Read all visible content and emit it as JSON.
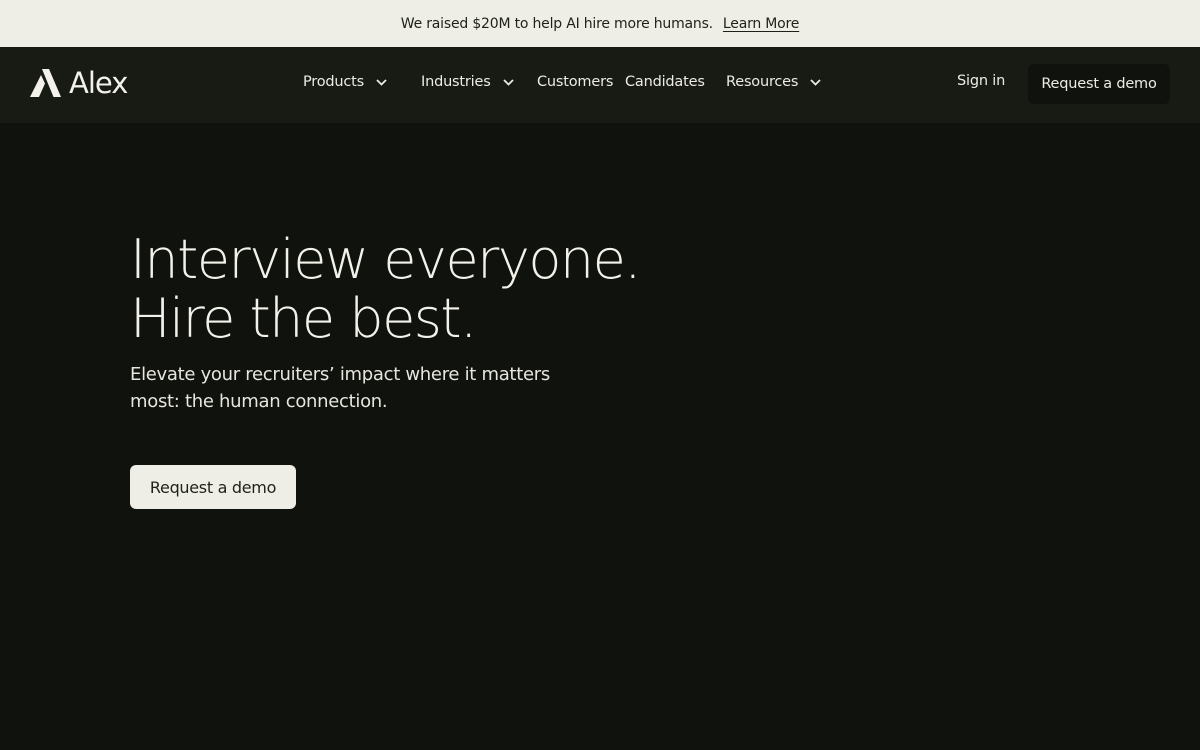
{
  "announcement": {
    "text": "We raised $20M to help AI hire more humans.",
    "link_label": "Learn More"
  },
  "header": {
    "logo_text": "Alex",
    "nav": [
      {
        "label": "Products",
        "has_dropdown": true
      },
      {
        "label": "Industries",
        "has_dropdown": true
      },
      {
        "label": "Customers",
        "has_dropdown": false
      },
      {
        "label": "Candidates",
        "has_dropdown": false
      },
      {
        "label": "Resources",
        "has_dropdown": true
      }
    ],
    "signin_label": "Sign in",
    "demo_label": "Request a demo"
  },
  "hero": {
    "title_line1": "Interview everyone.",
    "title_line2": "Hire the best.",
    "subtitle_line1": "Elevate your recruiters’ impact where it matters",
    "subtitle_line2": "most: the human connection.",
    "cta_label": "Request a demo"
  },
  "colors": {
    "background": "#10120d",
    "nav_background": "#181a14",
    "banner_background": "#eeeee6",
    "text_light": "#f2f2ea",
    "text_dark": "#1e201a"
  },
  "icons": [
    "logo-mark-icon",
    "chevron-down-icon"
  ]
}
